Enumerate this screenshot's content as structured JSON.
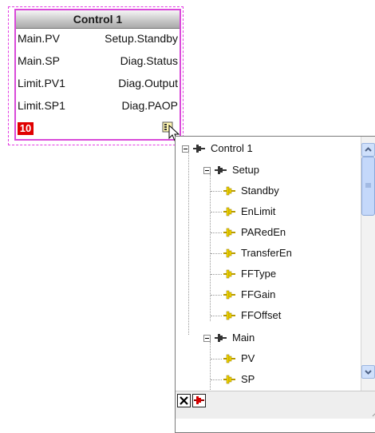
{
  "block": {
    "title": "Control 1",
    "left_pins": [
      "Main.PV",
      "Main.SP",
      "Limit.PV1",
      "Limit.SP1"
    ],
    "right_pins": [
      "Setup.Standby",
      "Diag.Status",
      "Diag.Output",
      "Diag.PAOP"
    ],
    "badge": "10"
  },
  "tree": {
    "root": "Control 1",
    "setup": {
      "label": "Setup",
      "children": [
        "Standby",
        "EnLimit",
        "PARedEn",
        "TransferEn",
        "FFType",
        "FFGain",
        "FFOffset"
      ]
    },
    "main": {
      "label": "Main",
      "children": [
        "PV",
        "SP"
      ]
    }
  },
  "colors": {
    "selection": "#e23be2",
    "badge": "#e00000",
    "connector_yellow": "#f2d600",
    "connector_red": "#d40000"
  }
}
